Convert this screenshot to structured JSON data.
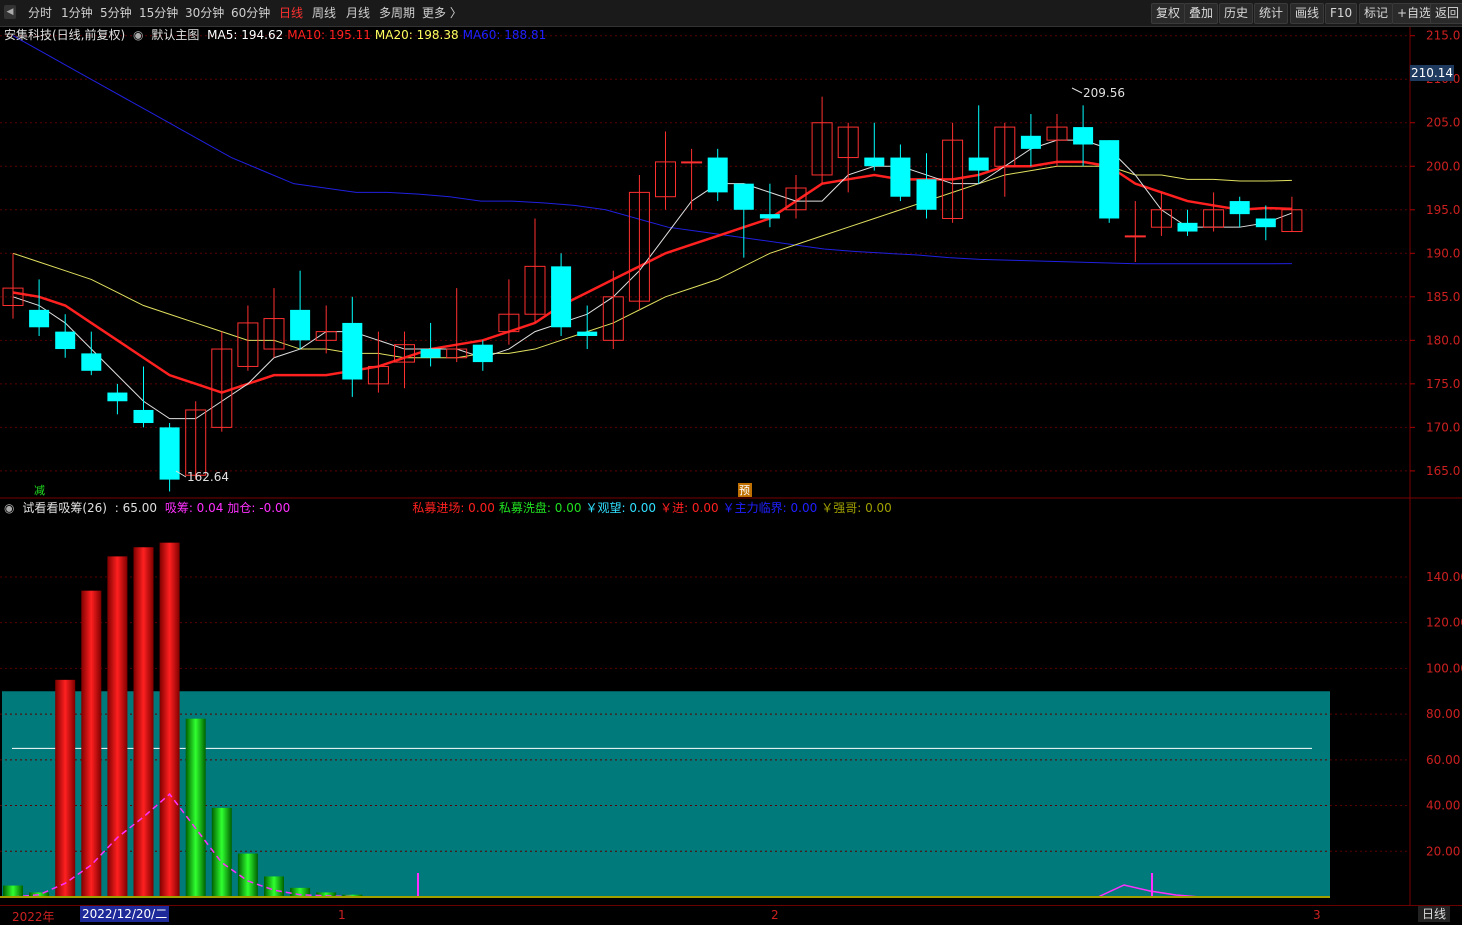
{
  "periods": [
    "分时",
    "1分钟",
    "5分钟",
    "15分钟",
    "30分钟",
    "60分钟",
    "日线",
    "周线",
    "月线",
    "多周期",
    "更多 〉"
  ],
  "active_period": "日线",
  "right_buttons": [
    "复权",
    "叠加",
    "历史",
    "统计",
    "画线",
    "F10",
    "标记",
    "+自选",
    "返回"
  ],
  "stock_title": "安集科技(日线,前复权)",
  "main_chart_label": "默认主图",
  "ma": [
    {
      "label": "MA5: 194.62",
      "color": "#ffffff"
    },
    {
      "label": "MA10: 195.11",
      "color": "#ff2020"
    },
    {
      "label": "MA20: 198.38",
      "color": "#ffff60"
    },
    {
      "label": "MA60: 188.81",
      "color": "#2020ff"
    }
  ],
  "current_price": "210.14",
  "price_axis": [
    "215.0",
    "210.0",
    "205.0",
    "200.0",
    "195.0",
    "190.0",
    "185.0",
    "180.0",
    "175.0",
    "170.0",
    "165.0"
  ],
  "high_label": "209.56",
  "low_label": "162.64",
  "mark_jian": "减",
  "mark_yu": "预",
  "indicator": {
    "name": "试看看吸筹(26)",
    "value": ": 65.00",
    "items": [
      {
        "label": "吸筹: 0.04",
        "color": "#ff30ff"
      },
      {
        "label": "加仓: -0.00",
        "color": "#ff30ff"
      },
      {
        "label": "私募进场: 0.00",
        "color": "#ff2020"
      },
      {
        "label": "私募洗盘: 0.00",
        "color": "#20e020"
      },
      {
        "label": "￥观望: 0.00",
        "color": "#30e0ff"
      },
      {
        "label": "￥进: 0.00",
        "color": "#ff2020"
      },
      {
        "label": "￥主力临界: 0.00",
        "color": "#2020ff"
      },
      {
        "label": "￥强哥: 0.00",
        "color": "#a0a000"
      }
    ],
    "axis": [
      "140.00",
      "120.00",
      "100.00",
      "80.00",
      "60.00",
      "40.00",
      "20.00"
    ]
  },
  "bottom_axis": {
    "year": "2022年",
    "date": "2022/12/20/二",
    "months": [
      "1",
      "2",
      "3"
    ],
    "period": "日线"
  },
  "colors": {
    "up": "#ff3030",
    "down": "#00ffff",
    "bg": "#000000",
    "teal": "#007f7f"
  },
  "chart_data": {
    "type": "candlestick",
    "candles": [
      [
        184,
        186,
        182.5,
        190
      ],
      [
        183.5,
        181.5,
        180.5,
        187
      ],
      [
        181,
        179,
        178,
        183
      ],
      [
        178.5,
        176.5,
        176,
        181
      ],
      [
        174,
        173,
        171.5,
        175
      ],
      [
        172,
        170.5,
        170,
        177
      ],
      [
        170,
        164,
        162.64,
        170.5
      ],
      [
        164.5,
        172,
        164,
        173
      ],
      [
        170,
        179,
        169.5,
        181
      ],
      [
        177,
        182,
        176.5,
        184
      ],
      [
        179,
        182.5,
        178,
        186
      ],
      [
        183.5,
        180,
        179,
        188
      ],
      [
        180,
        181,
        178.5,
        184
      ],
      [
        182,
        175.5,
        173.5,
        185
      ],
      [
        175,
        177,
        174,
        181
      ],
      [
        177.5,
        179.5,
        174.5,
        181
      ],
      [
        179,
        178,
        177,
        182
      ],
      [
        178,
        179,
        177.5,
        186
      ],
      [
        179.5,
        177.5,
        176.5,
        180
      ],
      [
        181,
        183,
        179.5,
        187
      ],
      [
        183,
        188.5,
        182,
        194
      ],
      [
        188.5,
        181.5,
        180.5,
        190
      ],
      [
        181,
        180.5,
        179,
        184
      ],
      [
        180,
        185,
        179,
        188
      ],
      [
        184.5,
        197,
        183.5,
        199
      ],
      [
        196.5,
        200.5,
        195,
        204
      ],
      [
        200.5,
        200.5,
        195,
        202
      ],
      [
        201,
        197,
        196,
        202
      ],
      [
        198,
        195,
        189.5,
        198
      ],
      [
        194.5,
        194,
        193,
        198
      ],
      [
        195,
        197.5,
        194,
        199
      ],
      [
        199,
        205,
        198,
        208
      ],
      [
        201,
        204.5,
        197,
        205
      ],
      [
        201,
        200,
        199.5,
        205
      ],
      [
        201,
        196.5,
        196,
        202.5
      ],
      [
        198.5,
        195,
        194,
        201.5
      ],
      [
        194,
        203,
        193.5,
        205
      ],
      [
        201,
        199.5,
        198,
        207
      ],
      [
        200,
        204.5,
        196.5,
        205
      ],
      [
        203.5,
        202,
        200,
        206
      ],
      [
        203,
        204.5,
        200,
        206
      ],
      [
        204.5,
        202.5,
        200,
        207
      ],
      [
        203,
        194,
        193.5,
        203
      ],
      [
        192,
        192,
        189,
        196
      ],
      [
        193,
        195,
        192,
        197
      ],
      [
        193.5,
        192.5,
        192,
        195
      ],
      [
        193,
        195,
        192.5,
        197
      ],
      [
        196,
        194.5,
        193,
        196.5
      ],
      [
        194,
        193,
        191.5,
        195.5
      ],
      [
        192.5,
        195,
        192.5,
        196.5
      ]
    ],
    "ma5": [
      185,
      184,
      182,
      179,
      176,
      173,
      171,
      171,
      173,
      175,
      178,
      179,
      181,
      181,
      180,
      179,
      179,
      179,
      178,
      179,
      181,
      182,
      183,
      185,
      188,
      192,
      196,
      198,
      198,
      197,
      196,
      196,
      199,
      200,
      200,
      199,
      198,
      198,
      200,
      202,
      203,
      203,
      202,
      199,
      195,
      193,
      193,
      193,
      193.5,
      194.62
    ],
    "ma10": [
      185.5,
      185,
      184,
      182,
      180,
      178,
      176,
      175,
      174,
      175,
      176,
      176,
      176,
      176.5,
      177,
      178,
      179,
      179.5,
      180,
      181,
      182,
      184,
      185.5,
      187,
      188.5,
      190,
      191,
      192,
      193,
      194,
      196,
      198,
      198.5,
      199,
      198.5,
      198.5,
      198.5,
      199,
      200,
      200,
      200.5,
      200.5,
      200,
      198,
      197,
      196,
      195.5,
      195,
      195.2,
      195.11
    ],
    "ma20": [
      190,
      189,
      188,
      187,
      185.5,
      184,
      183,
      182,
      181,
      180,
      180,
      179,
      179,
      178.5,
      178.5,
      178,
      178,
      178,
      178.5,
      178.5,
      179,
      180,
      181,
      182,
      183.5,
      185,
      186,
      187,
      188.5,
      190,
      191,
      192,
      193,
      194,
      195,
      196,
      197,
      198,
      199,
      199.5,
      200,
      200,
      200,
      199,
      199,
      198.5,
      198.5,
      198.3,
      198.3,
      198.38
    ],
    "ma60": [
      215,
      213,
      211,
      209,
      207,
      205,
      203,
      201,
      199.5,
      198,
      197.5,
      197,
      197,
      196.8,
      196.5,
      196,
      196,
      195.8,
      195.5,
      195,
      194,
      193,
      192.5,
      192,
      191.5,
      191,
      190.5,
      190.2,
      190,
      189.8,
      189.5,
      189.3,
      189.2,
      189.1,
      189,
      188.9,
      188.8,
      188.8,
      188.8,
      188.8,
      188.8,
      188.81
    ],
    "indicator_bars": [
      {
        "v": 5,
        "c": "green"
      },
      {
        "v": 2,
        "c": "green"
      },
      {
        "v": 95,
        "c": "red"
      },
      {
        "v": 134,
        "c": "red"
      },
      {
        "v": 149,
        "c": "red"
      },
      {
        "v": 153,
        "c": "red"
      },
      {
        "v": 155,
        "c": "red"
      },
      {
        "v": 78,
        "c": "green"
      },
      {
        "v": 39,
        "c": "green"
      },
      {
        "v": 19,
        "c": "green"
      },
      {
        "v": 9,
        "c": "green"
      },
      {
        "v": 4,
        "c": "green"
      },
      {
        "v": 2,
        "c": "green"
      },
      {
        "v": 1,
        "c": "green"
      }
    ],
    "xichou": [
      0,
      1,
      6,
      14,
      26,
      35,
      45,
      30,
      15,
      7,
      3,
      1,
      0.5,
      0.2
    ],
    "band_level": 90,
    "white_line": 65,
    "ylim_price": [
      162,
      216
    ],
    "ylim_ind": [
      0,
      160
    ]
  }
}
